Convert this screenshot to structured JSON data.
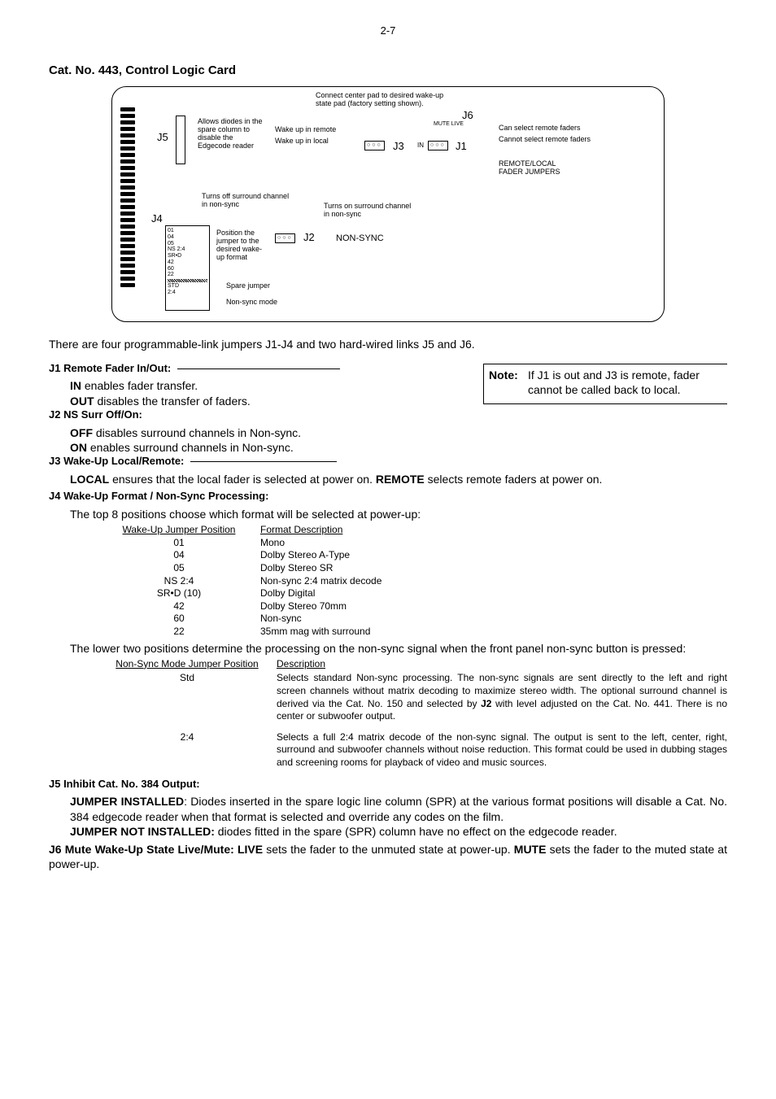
{
  "page_number": "2-7",
  "section_title": "Cat. No. 443, Control Logic Card",
  "diagram": {
    "connect_center": "Connect center pad to desired wake-up state pad (factory setting shown).",
    "j6": "J6",
    "mute_live": "MUTE   LIVE",
    "allows_diodes": "Allows diodes in the spare column to disable the Edgecode reader",
    "j5": "J5",
    "wake_remote": "Wake up in remote",
    "wake_local": "Wake up in local",
    "j3": "J3",
    "in": "IN",
    "j1": "J1",
    "can_select": "Can select remote faders",
    "cannot_select": "Cannot select remote faders",
    "remote_local": "REMOTE/LOCAL FADER JUMPERS",
    "turns_off": "Turns off surround channel in non-sync",
    "turns_on": "Turns on surround channel in non-sync",
    "j4": "J4",
    "j2": "J2",
    "non_sync": "NON-SYNC",
    "position_jumper": "Position the jumper to the desired wake-up format",
    "spare_jumper": "Spare jumper",
    "non_sync_mode": "Non-sync mode",
    "j4_items": [
      "01",
      "04",
      "05",
      "NS 2:4",
      "SR•D",
      "42",
      "60",
      "22",
      "",
      "STD",
      "2:4"
    ]
  },
  "intro": "There are four programmable-link jumpers J1-J4 and two hard-wired links J5 and J6.",
  "j1": {
    "label": "J1  Remote Fader In/Out:",
    "in": "IN",
    "in_text": " enables fader transfer.",
    "out": "OUT",
    "out_text": " disables the transfer of faders."
  },
  "note": {
    "lead": "Note:",
    "text": "If J1 is out and J3 is remote, fader cannot be called back to local."
  },
  "j2": {
    "label": "J2  NS Surr Off/On:",
    "off": "OFF",
    "off_text": " disables surround channels in Non-sync.",
    "on": "ON",
    "on_text": " enables surround channels in Non-sync."
  },
  "j3": {
    "label": "J3  Wake-Up Local/Remote:",
    "local": "LOCAL",
    "local_text": " ensures that the local fader is selected at power on.  ",
    "remote": "REMOTE",
    "remote_text": " selects remote faders at power on."
  },
  "j4": {
    "label": "J4  Wake-Up Format / Non-Sync Processing:",
    "intro": "The top 8 positions choose which format will be selected at power-up:",
    "head1": "Wake-Up Jumper Position",
    "head2": "Format Description",
    "rows": [
      {
        "p": "01",
        "d": "Mono"
      },
      {
        "p": "04",
        "d": "Dolby Stereo A-Type"
      },
      {
        "p": "05",
        "d": "Dolby Stereo SR"
      },
      {
        "p": "NS 2:4",
        "d": "Non-sync 2:4 matrix decode"
      },
      {
        "p": "SR•D (10)",
        "d": "Dolby Digital"
      },
      {
        "p": "42",
        "d": "Dolby Stereo 70mm"
      },
      {
        "p": "60",
        "d": "Non-sync"
      },
      {
        "p": "22",
        "d": "35mm mag with surround"
      }
    ],
    "lower": "The lower two positions determine the processing on the non-sync signal when the front panel non-sync button is pressed:",
    "head3": "Non-Sync Mode Jumper Position",
    "head4": "Description",
    "rows2": [
      {
        "p": "Std",
        "d": "Selects standard Non-sync processing. The non-sync signals are sent directly to the left and right screen channels without matrix decoding to maximize stereo width.  The optional surround channel is derived via the Cat. No. 150 and selected by ",
        "d2": "J2",
        "d3": " with level adjusted on the Cat. No. 441.  There is no center or subwoofer output."
      },
      {
        "p": "2:4",
        "d": "Selects a full 2:4 matrix decode of the non-sync signal.  The output is sent to the left, center, right, surround and subwoofer channels without noise reduction.  This format could be used in dubbing stages and screening rooms for playback of video and music sources.",
        "d2": "",
        "d3": ""
      }
    ]
  },
  "j5": {
    "label": "J5  Inhibit Cat. No. 384 Output:",
    "installed": "JUMPER INSTALLED",
    "installed_text": ":  Diodes inserted in the spare logic line column (SPR) at the various format positions will disable a Cat. No. 384 edgecode reader when that format is selected and override any codes on the film.",
    "not_installed": "JUMPER NOT INSTALLED:",
    "not_installed_text": "  diodes fitted in the spare (SPR) column have no effect on the edgecode reader."
  },
  "j6": {
    "label": "J6  Mute Wake-Up  State  Live/Mute:  ",
    "live": "LIVE",
    "live_text": " sets the fader to the unmuted state at power-up.  ",
    "mute": "MUTE",
    "mute_text": " sets the fader to the muted state at power-up."
  }
}
